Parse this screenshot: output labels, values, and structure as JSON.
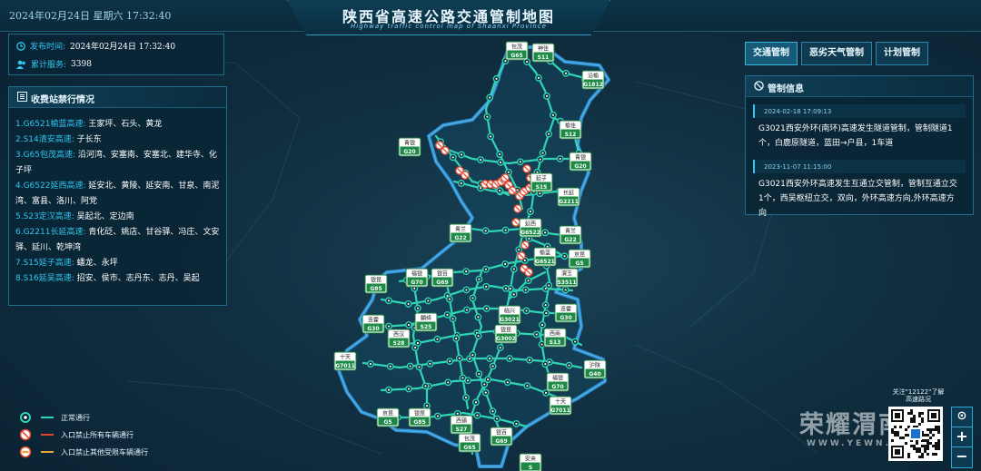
{
  "header": {
    "datetime": "2024年02月24日 星期六   17:32:40",
    "title": "陕西省高速公路交通管制地图",
    "subtitle": "Highway traffic control map of Shaanxi Province"
  },
  "info": {
    "publish_label": "发布时间:",
    "publish_value": "2024年02月24日   17:32:40",
    "service_label": "累计服务:",
    "service_value": "3398"
  },
  "toll": {
    "title": "收费站禁行情况",
    "items": [
      {
        "route": "1.G6521榆蓝高速:",
        "stations": " 王家坪、石头、黄龙"
      },
      {
        "route": "2.S14清安高速:",
        "stations": " 子长东"
      },
      {
        "route": "3.G65包茂高速:",
        "stations": " 沿河湾、安塞南、安塞北、建华寺、化子坪"
      },
      {
        "route": "4.G6522延西高速:",
        "stations": " 延安北、黄陵、延安南、甘泉、南泥湾、富县、洛川、阿党"
      },
      {
        "route": "5.S23定汉高速:",
        "stations": " 吴起北、定边南"
      },
      {
        "route": "6.G2211长延高速:",
        "stations": " 青化砭、姚店、甘谷驿、冯庄、文安驿、延川、乾坤湾"
      },
      {
        "route": "7.S15延子高速:",
        "stations": " 蟠龙、永坪"
      },
      {
        "route": "8.S16延吴高速:",
        "stations": " 招安、侯市、志丹东、志丹、吴起"
      }
    ]
  },
  "tabs": [
    "交通管制",
    "恶劣天气管制",
    "计划管制"
  ],
  "control": {
    "title": "管制信息",
    "notices": [
      {
        "time": "2024-02-18 17:09:13",
        "text": "G3021西安外环(南环)高速发生隧道管制，管制隧道1个，白鹿原隧道，蓝田→户县，1车道"
      },
      {
        "time": "2023-11-07 11:15:00",
        "text": "G3021西安外环高速发生互通立交管制，管制互通立交1个，西吴枢纽立交，双向，外环高速方向,外环高速方向"
      }
    ]
  },
  "legend": [
    {
      "icon": "normal-node-icon",
      "text": "正常通行",
      "color": "#2fd5b5"
    },
    {
      "icon": "no-entry-all-icon",
      "text": "入口禁止所有车辆通行",
      "color": "#e0452e"
    },
    {
      "icon": "no-entry-other-icon",
      "text": "入口禁止其他受限车辆通行",
      "color": "#f0a23a"
    }
  ],
  "shields": [
    {
      "name": "包茂",
      "code": "G65"
    },
    {
      "name": "神佳",
      "code": "S11"
    },
    {
      "name": "沿榆",
      "code": "G1812"
    },
    {
      "name": "榆佳",
      "code": "S12"
    },
    {
      "name": "青银",
      "code": "G20"
    },
    {
      "name": "青银",
      "code": "G20"
    },
    {
      "name": "延子",
      "code": "S15"
    },
    {
      "name": "长延",
      "code": "G2211"
    },
    {
      "name": "延西",
      "code": "G6522"
    },
    {
      "name": "青兰",
      "code": "G22"
    },
    {
      "name": "青兰",
      "code": "G22"
    },
    {
      "name": "榆蓝",
      "code": "G6521"
    },
    {
      "name": "京昆",
      "code": "G5"
    },
    {
      "name": "福银",
      "code": "G70"
    },
    {
      "name": "银百",
      "code": "G69"
    },
    {
      "name": "银昆",
      "code": "G85"
    },
    {
      "name": "渭玉",
      "code": "S3511"
    },
    {
      "name": "连霍",
      "code": "G30"
    },
    {
      "name": "麟绛",
      "code": "S25"
    },
    {
      "name": "临兴",
      "code": "G3021"
    },
    {
      "name": "连霍",
      "code": "G30"
    },
    {
      "name": "西汉",
      "code": "S28"
    },
    {
      "name": "银昆",
      "code": "G3002"
    },
    {
      "name": "西商",
      "code": "S13"
    },
    {
      "name": "十天",
      "code": "G7011"
    },
    {
      "name": "沪陕",
      "code": "G40"
    },
    {
      "name": "福银",
      "code": "G70"
    },
    {
      "name": "十天",
      "code": "G7011"
    },
    {
      "name": "京昆",
      "code": "G5"
    },
    {
      "name": "银昆",
      "code": "G85"
    },
    {
      "name": "西镇",
      "code": "S27"
    },
    {
      "name": "银百",
      "code": "G69"
    },
    {
      "name": "包茂",
      "code": "G65"
    },
    {
      "name": "安来",
      "code": "S"
    }
  ],
  "qr_caption": "关注\"12122\"了解高速路况",
  "watermark": "荣耀渭南",
  "watermark_url": "WWW.YEWN...",
  "controls": {
    "locate": "⊙",
    "zoom_in": "+",
    "zoom_out": "−"
  }
}
